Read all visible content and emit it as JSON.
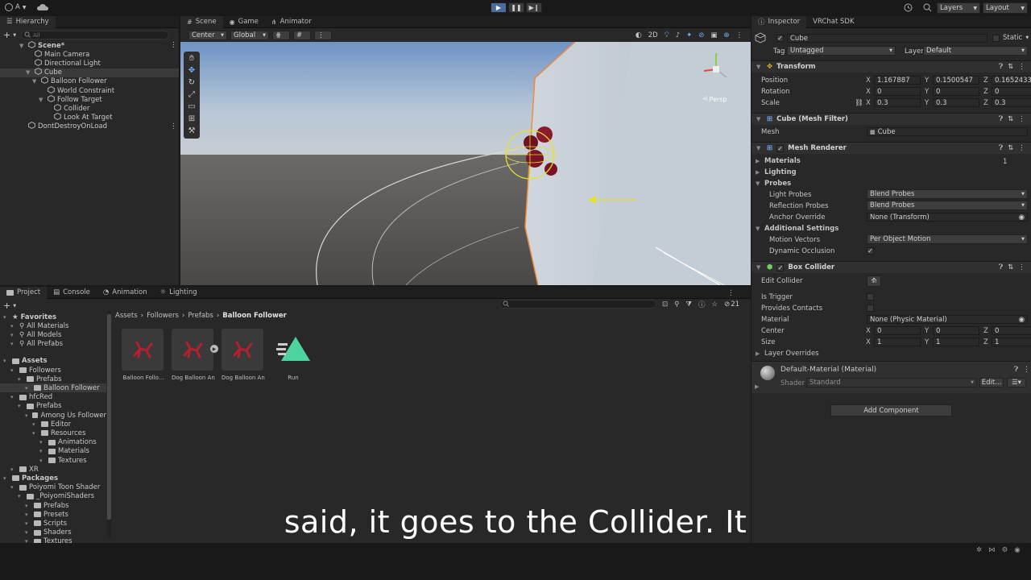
{
  "topbar": {
    "account_label": "A",
    "layers_label": "Layers",
    "layout_label": "Layout"
  },
  "hierarchy": {
    "tab_label": "Hierarchy",
    "search_placeholder": "All",
    "items": [
      {
        "label": "Scene*",
        "depth": 0
      },
      {
        "label": "Main Camera",
        "depth": 1
      },
      {
        "label": "Directional Light",
        "depth": 1
      },
      {
        "label": "Cube",
        "depth": 1
      },
      {
        "label": "Balloon Follower",
        "depth": 2
      },
      {
        "label": "World Constraint",
        "depth": 3
      },
      {
        "label": "Follow Target",
        "depth": 3
      },
      {
        "label": "Collider",
        "depth": 4
      },
      {
        "label": "Look At Target",
        "depth": 4
      },
      {
        "label": "DontDestroyOnLoad",
        "depth": 0
      }
    ]
  },
  "scene_tabs": [
    {
      "label": "Scene"
    },
    {
      "label": "Game"
    },
    {
      "label": "Animator"
    }
  ],
  "scene_toolbar": {
    "pivot_label": "Center",
    "space_label": "Global",
    "mode_2d_label": "2D"
  },
  "viewport": {
    "persp_label": "Persp"
  },
  "bottom_tabs": [
    {
      "label": "Project"
    },
    {
      "label": "Console"
    },
    {
      "label": "Animation"
    },
    {
      "label": "Lighting"
    }
  ],
  "project": {
    "breadcrumb": [
      "Assets",
      "Followers",
      "Prefabs",
      "Balloon Follower"
    ],
    "visible_count": "21",
    "tree": [
      {
        "label": "Favorites",
        "depth": 0,
        "bold": true
      },
      {
        "label": "All Materials",
        "depth": 1
      },
      {
        "label": "All Models",
        "depth": 1
      },
      {
        "label": "All Prefabs",
        "depth": 1
      },
      {
        "label": "Assets",
        "depth": 0,
        "bold": true
      },
      {
        "label": "Followers",
        "depth": 1
      },
      {
        "label": "Prefabs",
        "depth": 2
      },
      {
        "label": "Balloon Follower",
        "depth": 3
      },
      {
        "label": "hfcRed",
        "depth": 1
      },
      {
        "label": "Prefabs",
        "depth": 2
      },
      {
        "label": "Among Us Follower",
        "depth": 3
      },
      {
        "label": "Editor",
        "depth": 4
      },
      {
        "label": "Resources",
        "depth": 4
      },
      {
        "label": "Animations",
        "depth": 5
      },
      {
        "label": "Materials",
        "depth": 5
      },
      {
        "label": "Textures",
        "depth": 5
      },
      {
        "label": "XR",
        "depth": 1
      },
      {
        "label": "Packages",
        "depth": 0,
        "bold": true
      },
      {
        "label": "Poiyomi Toon Shader",
        "depth": 1
      },
      {
        "label": "_PoiyomiShaders",
        "depth": 2
      },
      {
        "label": "Prefabs",
        "depth": 3
      },
      {
        "label": "Presets",
        "depth": 3
      },
      {
        "label": "Scripts",
        "depth": 3
      },
      {
        "label": "Shaders",
        "depth": 3
      },
      {
        "label": "Textures",
        "depth": 3
      }
    ],
    "assets": [
      {
        "label": "Balloon Follo..."
      },
      {
        "label": "Dog Balloon An..."
      },
      {
        "label": "Dog Balloon An..."
      },
      {
        "label": "Run"
      }
    ]
  },
  "inspector": {
    "tabs": [
      {
        "label": "Inspector"
      },
      {
        "label": "VRChat SDK"
      }
    ],
    "object_name": "Cube",
    "static_label": "Static",
    "tag_label": "Tag",
    "tag_value": "Untagged",
    "layer_label": "Layer",
    "layer_value": "Default",
    "transform": {
      "title": "Transform",
      "position_label": "Position",
      "rotation_label": "Rotation",
      "scale_label": "Scale",
      "position": [
        "1.167887",
        "0.1500547",
        "0.1652433"
      ],
      "rotation": [
        "0",
        "0",
        "0"
      ],
      "scale": [
        "0.3",
        "0.3",
        "0.3"
      ]
    },
    "mesh_filter": {
      "title": "Cube (Mesh Filter)",
      "mesh_label": "Mesh",
      "mesh_value": "Cube"
    },
    "mesh_renderer": {
      "title": "Mesh Renderer",
      "materials_label": "Materials",
      "materials_count": "1",
      "lighting_label": "Lighting",
      "probes_label": "Probes",
      "light_probes_label": "Light Probes",
      "light_probes_value": "Blend Probes",
      "reflection_probes_label": "Reflection Probes",
      "reflection_probes_value": "Blend Probes",
      "anchor_override_label": "Anchor Override",
      "anchor_override_value": "None (Transform)",
      "additional_settings_label": "Additional Settings",
      "motion_vectors_label": "Motion Vectors",
      "motion_vectors_value": "Per Object Motion",
      "dynamic_occlusion_label": "Dynamic Occlusion"
    },
    "box_collider": {
      "title": "Box Collider",
      "edit_collider_label": "Edit Collider",
      "is_trigger_label": "Is Trigger",
      "provides_contacts_label": "Provides Contacts",
      "material_label": "Material",
      "material_value": "None (Physic Material)",
      "center_label": "Center",
      "center": [
        "0",
        "0",
        "0"
      ],
      "size_label": "Size",
      "size": [
        "1",
        "1",
        "1"
      ],
      "layer_overrides_label": "Layer Overrides"
    },
    "material": {
      "title": "Default-Material (Material)",
      "shader_label": "Shader",
      "shader_value": "Standard",
      "edit_label": "Edit..."
    },
    "add_component_label": "Add Component",
    "axis_x": "X",
    "axis_y": "Y",
    "axis_z": "Z"
  },
  "subtitle": "said, it goes to the Collider. It"
}
